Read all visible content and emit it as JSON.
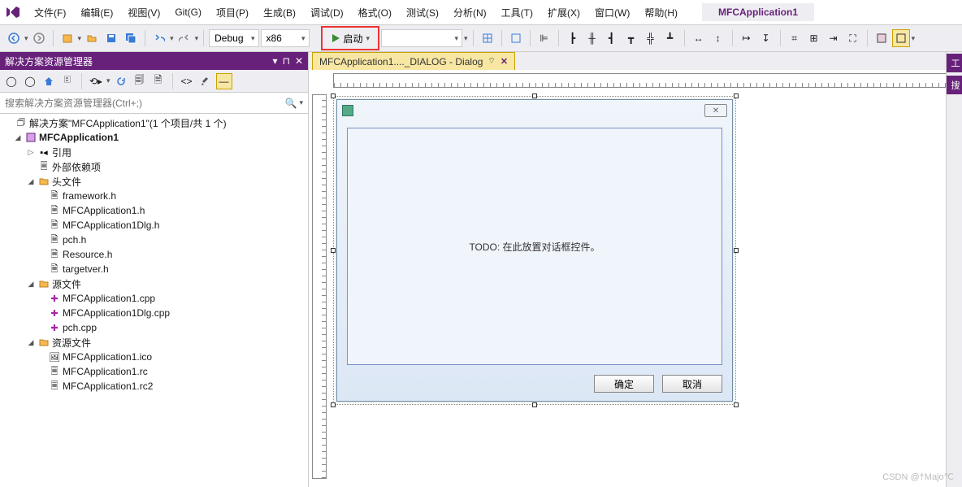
{
  "menu": {
    "items": [
      "文件(F)",
      "编辑(E)",
      "视图(V)",
      "Git(G)",
      "项目(P)",
      "生成(B)",
      "调试(D)",
      "格式(O)",
      "测试(S)",
      "分析(N)",
      "工具(T)",
      "扩展(X)",
      "窗口(W)",
      "帮助(H)"
    ],
    "project_title": "MFCApplication1"
  },
  "toolbar": {
    "config_combo": "Debug",
    "platform_combo": "x86",
    "run_label": "启动",
    "wide_combo": ""
  },
  "solution_panel": {
    "title": "解决方案资源管理器",
    "search_placeholder": "搜索解决方案资源管理器(Ctrl+;)",
    "search_icon": "🔍",
    "solution_label": "解决方案\"MFCApplication1\"(1 个项目/共 1 个)",
    "project": "MFCApplication1",
    "refs": "引用",
    "ext_deps": "外部依赖项",
    "headers_folder": "头文件",
    "headers": [
      "framework.h",
      "MFCApplication1.h",
      "MFCApplication1Dlg.h",
      "pch.h",
      "Resource.h",
      "targetver.h"
    ],
    "sources_folder": "源文件",
    "sources": [
      "MFCApplication1.cpp",
      "MFCApplication1Dlg.cpp",
      "pch.cpp"
    ],
    "resources_folder": "资源文件",
    "resources": [
      "MFCApplication1.ico",
      "MFCApplication1.rc",
      "MFCApplication1.rc2"
    ]
  },
  "editor": {
    "tab_label": "MFCApplication1...._DIALOG - Dialog",
    "dlg_todo": "TODO: 在此放置对话框控件。",
    "btn_ok": "确定",
    "btn_cancel": "取消"
  },
  "right_dock": {
    "tab1": "工",
    "tab2": "搜"
  },
  "watermark": "CSDN @†Majo℃"
}
